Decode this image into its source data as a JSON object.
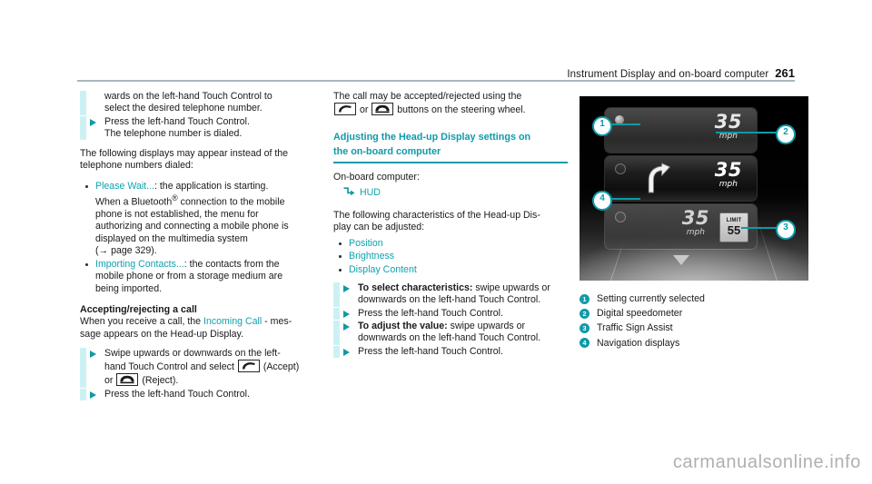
{
  "header": {
    "title": "Instrument Display and on-board computer",
    "page_number": "261"
  },
  "left_column": {
    "step1_line1": "wards on the left-hand Touch Control to",
    "step1_line2": "select the desired telephone number.",
    "step2_line1": "Press the left-hand Touch Control.",
    "step2_line2": "The telephone number is dialed.",
    "intro_line1": "The following displays may appear instead of the",
    "intro_line2": "telephone numbers dialed:",
    "bullet1_link": "Please Wait...",
    "bullet1_rest": ": the application is starting.",
    "bullet1_l2_a": "When a Bluetooth",
    "bullet1_l2_sup": "®",
    "bullet1_l2_b": " connection to the mobile",
    "bullet1_l3": "phone is not established, the menu for",
    "bullet1_l4": "authorizing and connecting a mobile phone is",
    "bullet1_l5": "displayed on the multimedia system",
    "bullet1_l6": "(→ page 329).",
    "bullet2_link": "Importing Contacts...",
    "bullet2_rest": ": the contacts from the",
    "bullet2_l2": "mobile phone or from a storage medium are",
    "bullet2_l3": "being imported.",
    "heading": "Accepting/rejecting a call",
    "para_a": "When you receive a call, the ",
    "para_link": "Incoming Call",
    "para_b": " - mes-",
    "para_c": "sage appears on the Head-up Display.",
    "step3_l1": "Swipe upwards or downwards on the left-",
    "step3_l2a": "hand Touch Control and select ",
    "step3_l2b": " (Accept)",
    "step3_l3a": "or ",
    "step3_l3b": " (Reject).",
    "step4": "Press the left-hand Touch Control.",
    "icon_accept": "phone-accept-icon",
    "icon_reject": "phone-reject-icon"
  },
  "middle_column": {
    "intro_l1": "The call may be accepted/rejected using the",
    "intro_l2a": " or ",
    "intro_l2b": " buttons on the steering wheel.",
    "section_heading_l1": "Adjusting the Head-up Display settings on",
    "section_heading_l2": "the on-board computer",
    "obc_label": "On-board computer:",
    "hud_path": "HUD",
    "hud_arrow_icon": "menu-path-arrow-icon",
    "desc_l1": "The following characteristics of the Head-up Dis-",
    "desc_l2": "play can be adjusted:",
    "options": [
      "Position",
      "Brightness",
      "Display Content"
    ],
    "step1_bold": "To select characteristics:",
    "step1_rest": " swipe upwards or",
    "step1_l2": "downwards on the left-hand Touch Control.",
    "step2": "Press the left-hand Touch Control.",
    "step3_bold": "To adjust the value:",
    "step3_rest": " swipe upwards or",
    "step3_l2": "downwards on the left-hand Touch Control.",
    "step4": "Press the left-hand Touch Control."
  },
  "figure": {
    "panels": [
      {
        "speed": "35",
        "unit": "mph",
        "selected": true,
        "has_nav_arrow": false,
        "has_limit_sign": false
      },
      {
        "speed": "35",
        "unit": "mph",
        "selected": false,
        "has_nav_arrow": true,
        "has_limit_sign": false
      },
      {
        "speed": "35",
        "unit": "mph",
        "selected": false,
        "has_nav_arrow": false,
        "has_limit_sign": true
      }
    ],
    "limit_sign": {
      "word": "LIMIT",
      "value": "55"
    },
    "callouts": [
      "1",
      "2",
      "3",
      "4"
    ],
    "scroll_chevron_icon": "chevron-down-icon"
  },
  "legend": {
    "items": [
      {
        "num": "1",
        "text": "Setting currently selected"
      },
      {
        "num": "2",
        "text": "Digital speedometer"
      },
      {
        "num": "3",
        "text": "Traffic Sign Assist"
      },
      {
        "num": "4",
        "text": "Navigation displays"
      }
    ]
  },
  "watermark": "carmanualsonline.info",
  "colors": {
    "teal": "#0f9aa8",
    "link_teal": "#0fa2ad",
    "step_bar": "#cdf1f3",
    "rule": "#a8b6bd"
  }
}
